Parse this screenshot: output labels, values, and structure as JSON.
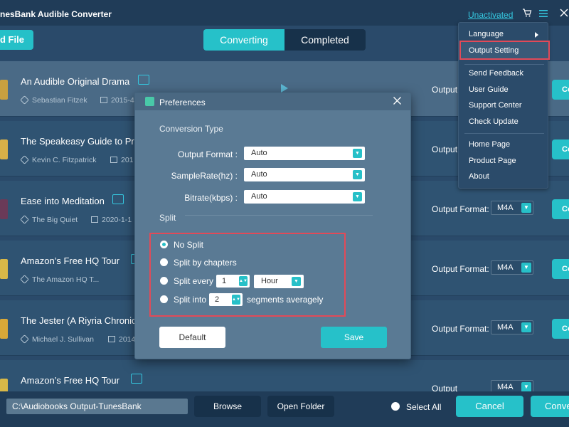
{
  "app": {
    "title": "nesBank Audible Converter",
    "unactivated": "Unactivated"
  },
  "toolbar": {
    "add_file": "d File"
  },
  "tabs": {
    "converting": "Converting",
    "completed": "Completed"
  },
  "books": [
    {
      "title": "An Audible Original Drama",
      "author": "Sebastian Fitzek",
      "date": "2015-4"
    },
    {
      "title": "The Speakeasy Guide to Pro",
      "author": "Kevin C. Fitzpatrick",
      "date": "201"
    },
    {
      "title": "Ease into Meditation",
      "author": "The Big Quiet",
      "date": "2020-1-1"
    },
    {
      "title": "Amazon’s Free HQ Tour",
      "author": "The Amazon HQ T...",
      "date": ""
    },
    {
      "title": "The Jester (A Riyria Chronicl",
      "author": "Michael J. Sullivan",
      "date": "2014"
    },
    {
      "title": "Amazon’s Free HQ Tour",
      "author": "",
      "date": ""
    }
  ],
  "row_labels": {
    "output_format": "Output Format:",
    "output_short": "Output",
    "format_value": "M4A",
    "convert_short": "Co"
  },
  "bottom": {
    "path": "C:\\Audiobooks Output-TunesBank",
    "browse": "Browse",
    "open_folder": "Open Folder",
    "select_all": "Select All",
    "cancel": "Cancel",
    "convert": "Conve"
  },
  "menu": {
    "items": [
      "Language",
      "Output Setting",
      "Send Feedback",
      "User Guide",
      "Support Center",
      "Check Update",
      "Home Page",
      "Product Page",
      "About"
    ]
  },
  "dialog": {
    "title": "Preferences",
    "conversion_type": "Conversion Type",
    "output_format_label": "Output Format :",
    "output_format_value": "Auto",
    "samplerate_label": "SampleRate(hz) :",
    "samplerate_value": "Auto",
    "bitrate_label": "Bitrate(kbps) :",
    "bitrate_value": "Auto",
    "split": "Split",
    "no_split": "No Split",
    "split_chapters": "Split by chapters",
    "split_every": "Split every",
    "split_every_value": "1",
    "split_every_unit": "Hour",
    "split_into": "Split into",
    "split_into_value": "2",
    "segments": "segments averagely",
    "default_btn": "Default",
    "save_btn": "Save"
  },
  "colors": {
    "accent": "#26c1c9",
    "highlight": "#e24a58",
    "background": "#2a4a6a"
  }
}
